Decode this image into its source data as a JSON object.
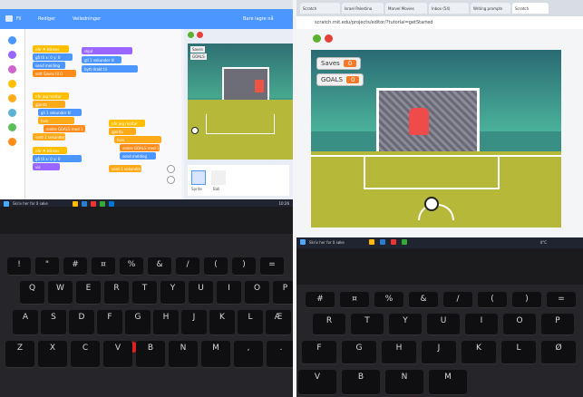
{
  "left_photo": {
    "menubar": {
      "file_label": "Fil",
      "edit_label": "Rediger",
      "tutorials_label": "Veiledninger",
      "save_status": "Bare lagre nå"
    },
    "blocks": [
      "når ⚑ klikkes",
      "gå til x: 0 y: 0",
      "send melding",
      "gjenta",
      "hvis",
      "sett Saves til 0",
      "endre GOALS med 1",
      "vent 1 sekunder",
      "når jeg mottar",
      "gli 1 sekunder til",
      "bytt drakt til",
      "vis",
      "skjul"
    ],
    "monitors": {
      "saves_label": "Saves",
      "goals_label": "GOALS"
    },
    "sprite_labels": [
      "Sprite",
      "Ball"
    ],
    "taskbar": {
      "search_text": "Skriv her for å søke",
      "time": "10:26"
    },
    "keys_row1": [
      "!",
      "\"",
      "#",
      "¤",
      "%",
      "&",
      "/",
      "(",
      ")",
      "="
    ],
    "keys_row2": [
      "Q",
      "W",
      "E",
      "R",
      "T",
      "Y",
      "U",
      "I",
      "O",
      "P"
    ],
    "keys_row3": [
      "A",
      "S",
      "D",
      "F",
      "G",
      "H",
      "J",
      "K",
      "L",
      "Æ"
    ],
    "keys_row4": [
      "Z",
      "X",
      "C",
      "V",
      "B",
      "N",
      "M",
      ",",
      "."
    ]
  },
  "right_photo": {
    "tabs": [
      "Scratch",
      "Israel Palestina",
      "Marvel Movies",
      "Inbox (54)",
      "Writing prompts",
      "Scratch"
    ],
    "url": "scratch.mit.edu/projects/editor/?tutorial=getStarted",
    "monitors": {
      "saves_label": "Saves",
      "saves_value": "0",
      "goals_label": "GOALS",
      "goals_value": "0"
    },
    "taskbar": {
      "search_text": "Skriv her for å søke",
      "weather": "4°C"
    },
    "keys_row1": [
      "#",
      "¤",
      "%",
      "&",
      "/",
      "(",
      ")",
      "="
    ],
    "keys_row2": [
      "R",
      "T",
      "Y",
      "U",
      "I",
      "O",
      "P"
    ],
    "keys_row3": [
      "F",
      "G",
      "H",
      "J",
      "K",
      "L",
      "Ø"
    ],
    "keys_row4": [
      "V",
      "B",
      "N",
      "M"
    ]
  },
  "colors": {
    "scratch_blue": "#4c97ff",
    "stage_teal": "#3a8f85",
    "pitch_green": "#b6b83a",
    "monitor_orange": "#f47a27",
    "trackpoint_red": "#dd2222"
  }
}
